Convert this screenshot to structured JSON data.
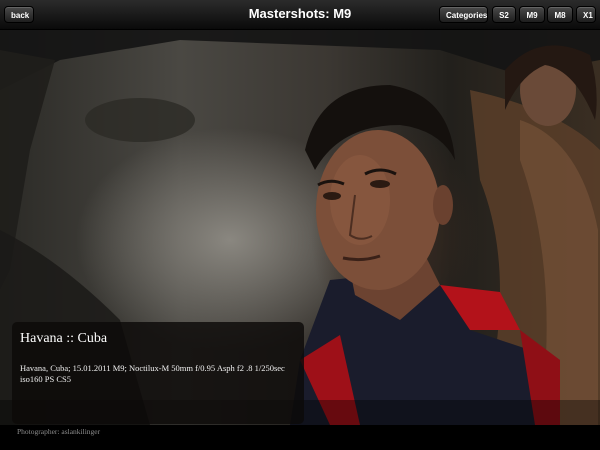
{
  "header": {
    "title": "Mastershots: M9",
    "back_label": "back",
    "buttons": [
      "Categories",
      "S2",
      "M9",
      "M8",
      "X1"
    ]
  },
  "caption": {
    "title": "Havana :: Cuba",
    "description": "Havana, Cuba; 15.01.2011 M9; Noctilux-M 50mm f/0.95 Asph  f2 .8 1/250sec iso160 PS CS5"
  },
  "footer": {
    "photographer": "Photographer: aslankilinger"
  },
  "colors": {
    "topbar": "#1a1a1a",
    "caption_bg": "#0c0a08",
    "shirt_red": "#b3121a"
  }
}
